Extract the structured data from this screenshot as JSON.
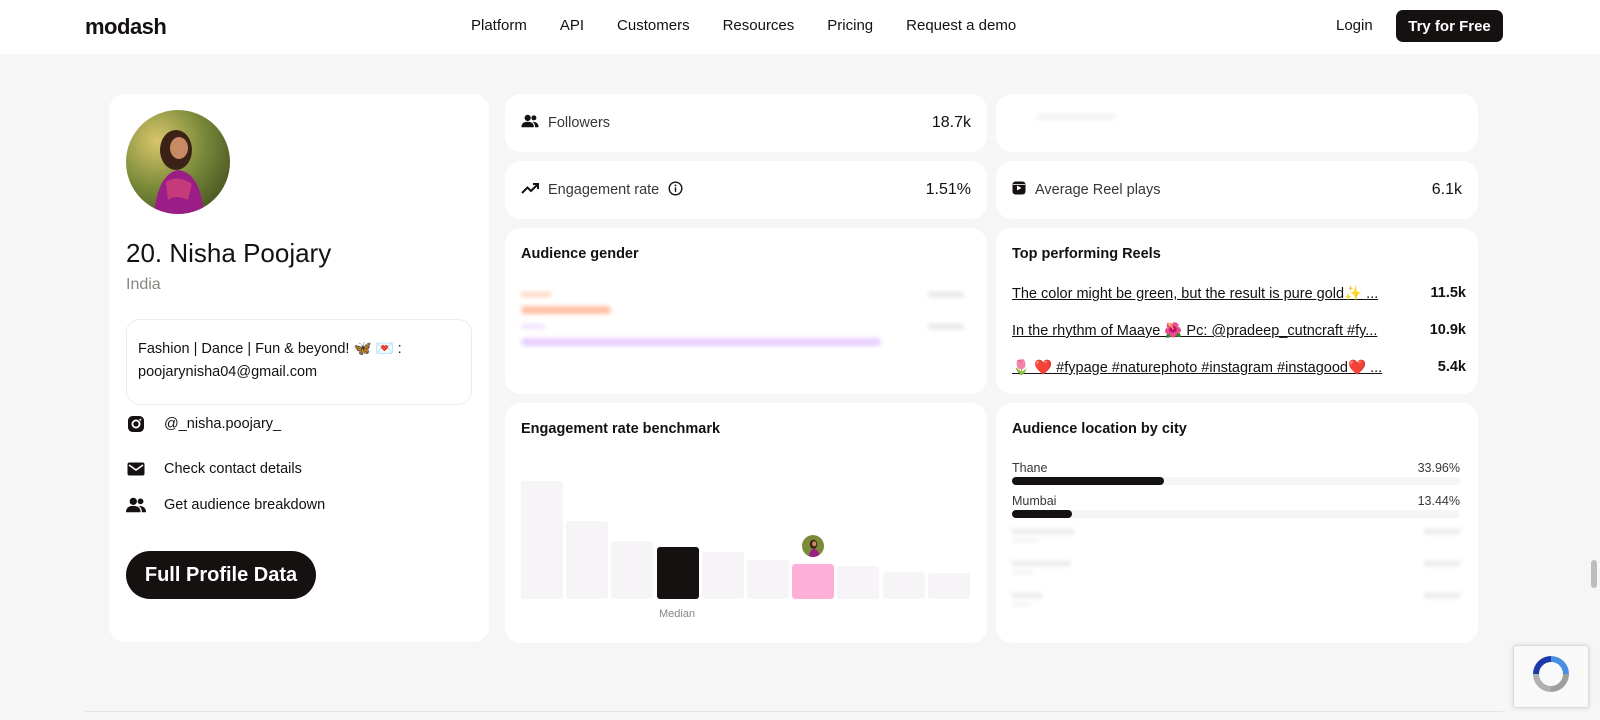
{
  "nav": {
    "logo": "modash",
    "links": [
      "Platform",
      "API",
      "Customers",
      "Resources",
      "Pricing",
      "Request a demo"
    ],
    "login": "Login",
    "cta": "Try for Free"
  },
  "profile": {
    "name": "20. Nisha Poojary",
    "country": "India",
    "bio": "Fashion | Dance | Fun & beyond! 🦋 💌 : poojarynisha04@gmail.com",
    "handle": "@_nisha.poojary_",
    "contact": "Check contact details",
    "audience": "Get audience breakdown",
    "button": "Full Profile Data"
  },
  "stats": {
    "followers_label": "Followers",
    "followers_value": "18.7k",
    "engagement_label": "Engagement rate",
    "engagement_value": "1.51%",
    "reel_label": "Average Reel plays",
    "reel_value": "6.1k"
  },
  "gender": {
    "title": "Audience gender",
    "bars": [
      {
        "color": "#ff8c5a",
        "fraction": 0.2
      },
      {
        "color": "#d8a8ff",
        "fraction": 0.8
      }
    ]
  },
  "reels": {
    "title": "Top performing Reels",
    "items": [
      {
        "title": "The color might be green, but the result is pure gold✨ ...",
        "value": "11.5k"
      },
      {
        "title": "In the rhythm of Maaye 🌺 Pc: @pradeep_cutncraft #fy...",
        "value": "10.9k"
      },
      {
        "title": "🌷 ❤️ #fypage #naturephoto #instagram #instagood❤️ ...",
        "value": "5.4k"
      }
    ]
  },
  "benchmark": {
    "title": "Engagement rate benchmark",
    "median_label": "Median",
    "levels": [
      1.0,
      0.66,
      0.49,
      0.44,
      0.4,
      0.33,
      0.3,
      0.28,
      0.23,
      0.22
    ],
    "median_index": 3,
    "profile_index": 6
  },
  "city": {
    "title": "Audience location by city",
    "items": [
      {
        "name": "Thane",
        "value": "33.96%",
        "fraction": 0.3396
      },
      {
        "name": "Mumbai",
        "value": "13.44%",
        "fraction": 0.1344
      }
    ]
  },
  "colors": {
    "dark": "#141110",
    "profile_bar": "#ffb0d8",
    "bench_bar": "#f6f4f7"
  }
}
